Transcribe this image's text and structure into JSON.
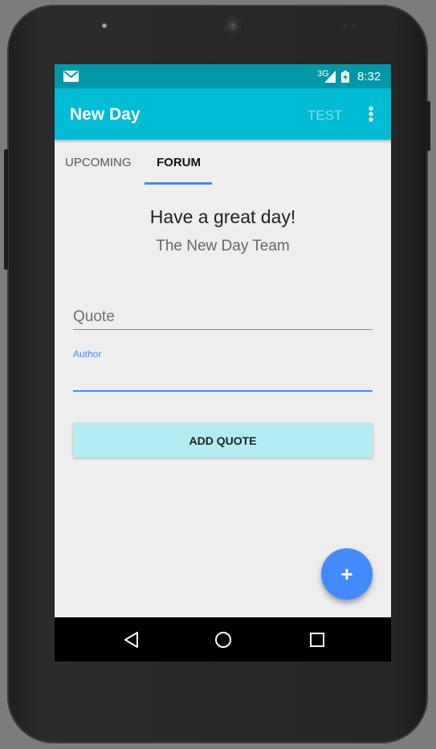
{
  "status_bar": {
    "signal": "3G",
    "time": "8:32"
  },
  "app_bar": {
    "title": "New Day",
    "action_test": "TEST"
  },
  "tabs": [
    {
      "label": "UPCOMING",
      "selected": false
    },
    {
      "label": "FORUM",
      "selected": true
    }
  ],
  "content": {
    "headline": "Have a great day!",
    "subheadline": "The New Day Team"
  },
  "form": {
    "quote_placeholder": "Quote",
    "quote_value": "",
    "author_label": "Author",
    "author_value": "",
    "add_button_label": "ADD QUOTE"
  },
  "fab": {
    "label": "+"
  },
  "colors": {
    "status_bar": "#0097a7",
    "app_bar": "#00bcd4",
    "accent": "#448aff",
    "button_bg": "#b2ebf2"
  },
  "icons": [
    "message-icon",
    "signal-icon",
    "battery-icon",
    "more-vert-icon",
    "back-icon",
    "home-icon",
    "recents-icon"
  ]
}
